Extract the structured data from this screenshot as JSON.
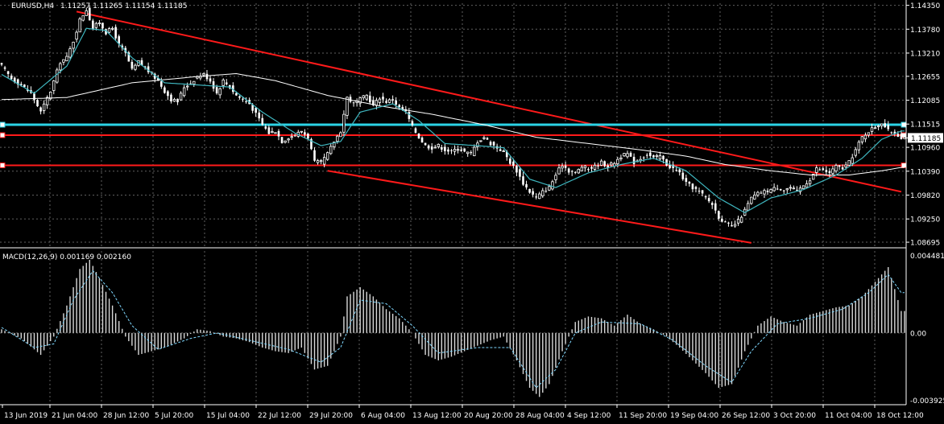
{
  "colors": {
    "background": "#000000",
    "grid": "#5f5f5f",
    "text": "#ffffff",
    "bull_candle": "#ffffff",
    "bear_candle": "#ffffff",
    "moving_average_fast": "#3fb7c0",
    "moving_average_slow": "#ffffff",
    "trendline": "#ff1a1a",
    "support_resistance_cyan": "#2bd3e6",
    "support_resistance_red": "#ff1a1a",
    "price_marker_bg": "#ffffff",
    "price_marker_text": "#000000",
    "macd_hist": "#d9d9d9",
    "macd_signal": "#7fd8ff"
  },
  "chart_data": [
    {
      "type": "candlestick",
      "title": "EURUSD,H4",
      "ohlc_header": "1.11257 1.11265 1.11154 1.11185",
      "price_axis_labels": [
        "1.14350",
        "1.13780",
        "1.13210",
        "1.12655",
        "1.12085",
        "1.11515",
        "1.11185",
        "1.10960",
        "1.10390",
        "1.09820",
        "1.09250",
        "1.08695"
      ],
      "current_price": "1.11185",
      "ylim": [
        1.086,
        1.144
      ],
      "time_axis_labels": [
        "13 Jun 2019",
        "21 Jun 04:00",
        "28 Jun 12:00",
        "5 Jul 20:00",
        "15 Jul 04:00",
        "22 Jul 12:00",
        "29 Jul 20:00",
        "6 Aug 04:00",
        "13 Aug 12:00",
        "20 Aug 20:00",
        "28 Aug 04:00",
        "4 Sep 12:00",
        "11 Sep 20:00",
        "19 Sep 04:00",
        "26 Sep 12:00",
        "3 Oct 20:00",
        "11 Oct 04:00",
        "18 Oct 12:00"
      ],
      "price_path": [
        [
          0,
          1.129
        ],
        [
          3,
          1.126
        ],
        [
          6,
          1.1245
        ],
        [
          9,
          1.1225
        ],
        [
          12,
          1.118
        ],
        [
          15,
          1.123
        ],
        [
          18,
          1.13
        ],
        [
          20,
          1.131
        ],
        [
          22,
          1.135
        ],
        [
          24,
          1.14
        ],
        [
          26,
          1.1425
        ],
        [
          28,
          1.138
        ],
        [
          30,
          1.1395
        ],
        [
          32,
          1.137
        ],
        [
          34,
          1.138
        ],
        [
          36,
          1.134
        ],
        [
          38,
          1.132
        ],
        [
          40,
          1.128
        ],
        [
          42,
          1.13
        ],
        [
          44,
          1.1285
        ],
        [
          46,
          1.127
        ],
        [
          48,
          1.1255
        ],
        [
          50,
          1.123
        ],
        [
          52,
          1.121
        ],
        [
          54,
          1.1205
        ],
        [
          56,
          1.124
        ],
        [
          58,
          1.125
        ],
        [
          60,
          1.1265
        ],
        [
          62,
          1.127
        ],
        [
          64,
          1.1255
        ],
        [
          66,
          1.1225
        ],
        [
          68,
          1.1255
        ],
        [
          70,
          1.124
        ],
        [
          72,
          1.122
        ],
        [
          74,
          1.121
        ],
        [
          76,
          1.12
        ],
        [
          78,
          1.1175
        ],
        [
          80,
          1.115
        ],
        [
          82,
          1.113
        ],
        [
          84,
          1.1135
        ],
        [
          86,
          1.111
        ],
        [
          88,
          1.112
        ],
        [
          90,
          1.1125
        ],
        [
          92,
          1.1135
        ],
        [
          94,
          1.112
        ],
        [
          96,
          1.106
        ],
        [
          98,
          1.106
        ],
        [
          100,
          1.108
        ],
        [
          102,
          1.111
        ],
        [
          104,
          1.1135
        ],
        [
          106,
          1.1215
        ],
        [
          108,
          1.12
        ],
        [
          110,
          1.121
        ],
        [
          112,
          1.122
        ],
        [
          114,
          1.1195
        ],
        [
          116,
          1.1215
        ],
        [
          118,
          1.1205
        ],
        [
          120,
          1.121
        ],
        [
          122,
          1.119
        ],
        [
          124,
          1.118
        ],
        [
          126,
          1.1145
        ],
        [
          128,
          1.112
        ],
        [
          130,
          1.11
        ],
        [
          132,
          1.1095
        ],
        [
          134,
          1.11
        ],
        [
          136,
          1.109
        ],
        [
          138,
          1.1085
        ],
        [
          140,
          1.1095
        ],
        [
          142,
          1.1085
        ],
        [
          144,
          1.108
        ],
        [
          146,
          1.111
        ],
        [
          148,
          1.112
        ],
        [
          150,
          1.1105
        ],
        [
          152,
          1.1095
        ],
        [
          154,
          1.1085
        ],
        [
          156,
          1.106
        ],
        [
          158,
          1.104
        ],
        [
          160,
          1.101
        ],
        [
          162,
          1.099
        ],
        [
          164,
          1.0975
        ],
        [
          166,
          1.099
        ],
        [
          168,
          1.1
        ],
        [
          170,
          1.103
        ],
        [
          172,
          1.1055
        ],
        [
          174,
          1.104
        ],
        [
          176,
          1.1035
        ],
        [
          178,
          1.105
        ],
        [
          180,
          1.1045
        ],
        [
          182,
          1.105
        ],
        [
          184,
          1.106
        ],
        [
          186,
          1.105
        ],
        [
          188,
          1.106
        ],
        [
          190,
          1.1075
        ],
        [
          192,
          1.108
        ],
        [
          194,
          1.106
        ],
        [
          196,
          1.107
        ],
        [
          198,
          1.108
        ],
        [
          200,
          1.107
        ],
        [
          202,
          1.1075
        ],
        [
          204,
          1.1055
        ],
        [
          206,
          1.1045
        ],
        [
          208,
          1.1035
        ],
        [
          210,
          1.101
        ],
        [
          212,
          1.1
        ],
        [
          214,
          1.099
        ],
        [
          216,
          1.0975
        ],
        [
          218,
          1.096
        ],
        [
          220,
          1.093
        ],
        [
          222,
          1.0915
        ],
        [
          224,
          1.0905
        ],
        [
          226,
          1.092
        ],
        [
          228,
          1.0945
        ],
        [
          230,
          1.0975
        ],
        [
          232,
          1.0985
        ],
        [
          234,
          1.099
        ],
        [
          236,
          1.0995
        ],
        [
          238,
          1.1
        ],
        [
          240,
          1.0995
        ],
        [
          242,
          1.1
        ],
        [
          244,
          1.099
        ],
        [
          246,
          1.1005
        ],
        [
          248,
          1.102
        ],
        [
          250,
          1.1045
        ],
        [
          252,
          1.104
        ],
        [
          254,
          1.1035
        ],
        [
          256,
          1.105
        ],
        [
          258,
          1.1045
        ],
        [
          260,
          1.106
        ],
        [
          262,
          1.109
        ],
        [
          264,
          1.112
        ],
        [
          266,
          1.1135
        ],
        [
          268,
          1.1145
        ],
        [
          270,
          1.1155
        ],
        [
          272,
          1.1135
        ],
        [
          274,
          1.113
        ],
        [
          276,
          1.112
        ]
      ],
      "sma_fast_path": [
        [
          0,
          1.127
        ],
        [
          10,
          1.1225
        ],
        [
          20,
          1.129
        ],
        [
          26,
          1.138
        ],
        [
          32,
          1.1375
        ],
        [
          40,
          1.131
        ],
        [
          50,
          1.125
        ],
        [
          60,
          1.1245
        ],
        [
          70,
          1.124
        ],
        [
          80,
          1.118
        ],
        [
          90,
          1.113
        ],
        [
          98,
          1.11
        ],
        [
          104,
          1.111
        ],
        [
          110,
          1.118
        ],
        [
          120,
          1.12
        ],
        [
          128,
          1.116
        ],
        [
          136,
          1.1105
        ],
        [
          146,
          1.11
        ],
        [
          154,
          1.1095
        ],
        [
          162,
          1.102
        ],
        [
          170,
          1.1
        ],
        [
          180,
          1.1035
        ],
        [
          190,
          1.1055
        ],
        [
          200,
          1.107
        ],
        [
          210,
          1.104
        ],
        [
          220,
          1.0975
        ],
        [
          228,
          1.094
        ],
        [
          236,
          1.0975
        ],
        [
          246,
          1.0995
        ],
        [
          256,
          1.103
        ],
        [
          264,
          1.107
        ],
        [
          270,
          1.1115
        ],
        [
          276,
          1.1135
        ]
      ],
      "sma_slow_path": [
        [
          0,
          1.121
        ],
        [
          20,
          1.1215
        ],
        [
          40,
          1.125
        ],
        [
          60,
          1.1265
        ],
        [
          72,
          1.1272
        ],
        [
          84,
          1.1255
        ],
        [
          100,
          1.122
        ],
        [
          116,
          1.1195
        ],
        [
          132,
          1.1175
        ],
        [
          148,
          1.115
        ],
        [
          164,
          1.112
        ],
        [
          180,
          1.1105
        ],
        [
          196,
          1.109
        ],
        [
          210,
          1.1075
        ],
        [
          222,
          1.1055
        ],
        [
          236,
          1.104
        ],
        [
          248,
          1.103
        ],
        [
          260,
          1.103
        ],
        [
          270,
          1.104
        ],
        [
          276,
          1.1048
        ]
      ],
      "horizontal_levels": [
        {
          "color": "cyan",
          "price": 1.115
        },
        {
          "color": "red",
          "price": 1.1125
        },
        {
          "color": "red",
          "price": 1.1053
        }
      ],
      "trendlines": [
        {
          "from": [
            23,
            1.142
          ],
          "to": [
            276,
            1.099
          ]
        },
        {
          "from": [
            100,
            1.104
          ],
          "to": [
            230,
            1.0868
          ]
        }
      ]
    },
    {
      "type": "bar",
      "title": "MACD(12,26,9) 0.001169 0.002160",
      "axis_labels": [
        "0.004481",
        "0.00",
        "-0.003925"
      ],
      "ylim": [
        -0.003925,
        0.004481
      ],
      "macd_path": [
        [
          0,
          0.0002
        ],
        [
          6,
          -0.0003
        ],
        [
          12,
          -0.0012
        ],
        [
          16,
          -0.0002
        ],
        [
          20,
          0.0015
        ],
        [
          24,
          0.0035
        ],
        [
          27,
          0.004
        ],
        [
          30,
          0.003
        ],
        [
          34,
          0.0015
        ],
        [
          38,
          -0.0002
        ],
        [
          42,
          -0.0012
        ],
        [
          46,
          -0.001
        ],
        [
          50,
          -0.0008
        ],
        [
          56,
          -0.0003
        ],
        [
          60,
          0.0002
        ],
        [
          64,
          0.0001
        ],
        [
          68,
          -0.0002
        ],
        [
          72,
          -0.0003
        ],
        [
          76,
          -0.0005
        ],
        [
          80,
          -0.0008
        ],
        [
          84,
          -0.001
        ],
        [
          88,
          -0.0011
        ],
        [
          92,
          -0.0008
        ],
        [
          96,
          -0.002
        ],
        [
          100,
          -0.0018
        ],
        [
          104,
          -0.0002
        ],
        [
          106,
          0.002
        ],
        [
          110,
          0.0025
        ],
        [
          114,
          0.002
        ],
        [
          118,
          0.0013
        ],
        [
          122,
          0.0008
        ],
        [
          126,
          0.0
        ],
        [
          130,
          -0.0012
        ],
        [
          134,
          -0.0015
        ],
        [
          138,
          -0.0013
        ],
        [
          142,
          -0.001
        ],
        [
          146,
          -0.0007
        ],
        [
          150,
          -0.0004
        ],
        [
          154,
          -0.0002
        ],
        [
          158,
          -0.0015
        ],
        [
          162,
          -0.003
        ],
        [
          165,
          -0.0035
        ],
        [
          168,
          -0.0028
        ],
        [
          172,
          -0.001
        ],
        [
          176,
          0.0006
        ],
        [
          180,
          0.0009
        ],
        [
          184,
          0.0008
        ],
        [
          188,
          0.0004
        ],
        [
          192,
          0.001
        ],
        [
          196,
          0.0005
        ],
        [
          200,
          0.0002
        ],
        [
          204,
          -0.0002
        ],
        [
          208,
          -0.0008
        ],
        [
          212,
          -0.0015
        ],
        [
          216,
          -0.0022
        ],
        [
          220,
          -0.003
        ],
        [
          224,
          -0.0028
        ],
        [
          228,
          -0.001
        ],
        [
          232,
          0.0004
        ],
        [
          236,
          0.0009
        ],
        [
          240,
          0.0006
        ],
        [
          244,
          0.0004
        ],
        [
          248,
          0.001
        ],
        [
          252,
          0.0012
        ],
        [
          256,
          0.0014
        ],
        [
          260,
          0.0015
        ],
        [
          264,
          0.002
        ],
        [
          268,
          0.0028
        ],
        [
          272,
          0.0036
        ],
        [
          276,
          0.0012
        ]
      ],
      "signal_path": [
        [
          0,
          0.0003
        ],
        [
          10,
          -0.0008
        ],
        [
          16,
          -0.0006
        ],
        [
          22,
          0.0018
        ],
        [
          28,
          0.0034
        ],
        [
          34,
          0.0022
        ],
        [
          40,
          0.0004
        ],
        [
          48,
          -0.0009
        ],
        [
          58,
          -0.0003
        ],
        [
          66,
          0.0
        ],
        [
          76,
          -0.0004
        ],
        [
          88,
          -0.0009
        ],
        [
          98,
          -0.0016
        ],
        [
          104,
          -0.0008
        ],
        [
          110,
          0.0018
        ],
        [
          118,
          0.0016
        ],
        [
          126,
          0.0004
        ],
        [
          134,
          -0.0011
        ],
        [
          146,
          -0.0008
        ],
        [
          156,
          -0.0008
        ],
        [
          164,
          -0.003
        ],
        [
          170,
          -0.002
        ],
        [
          176,
          0.0
        ],
        [
          184,
          0.0006
        ],
        [
          196,
          0.0005
        ],
        [
          206,
          -0.0004
        ],
        [
          216,
          -0.0018
        ],
        [
          224,
          -0.0027
        ],
        [
          230,
          -0.001
        ],
        [
          238,
          0.0005
        ],
        [
          248,
          0.0008
        ],
        [
          258,
          0.0013
        ],
        [
          266,
          0.0022
        ],
        [
          272,
          0.0032
        ],
        [
          276,
          0.0022
        ]
      ]
    }
  ]
}
